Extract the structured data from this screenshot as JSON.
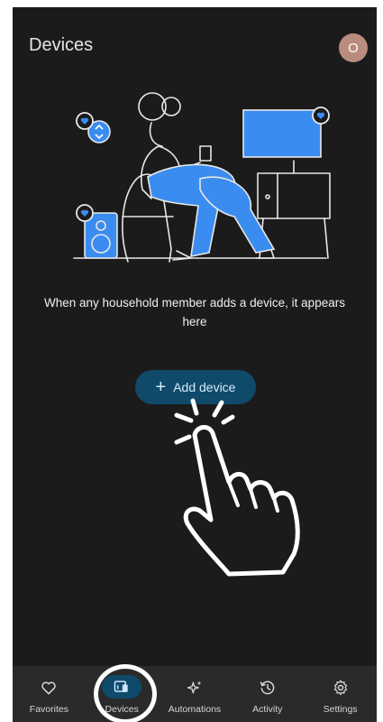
{
  "header": {
    "title": "Devices",
    "avatar_initial": "O"
  },
  "empty_state": {
    "message": "When any household member adds a device, it appears here",
    "add_button_label": "Add device"
  },
  "bottom_nav": {
    "items": [
      {
        "label": "Favorites",
        "icon": "heart-icon"
      },
      {
        "label": "Devices",
        "icon": "devices-icon",
        "active": true
      },
      {
        "label": "Automations",
        "icon": "sparkle-icon"
      },
      {
        "label": "Activity",
        "icon": "history-icon"
      },
      {
        "label": "Settings",
        "icon": "gear-icon"
      }
    ]
  },
  "colors": {
    "background": "#1b1b1b",
    "accent": "#0f4a6a",
    "illustration_blue": "#3b8cf0"
  }
}
